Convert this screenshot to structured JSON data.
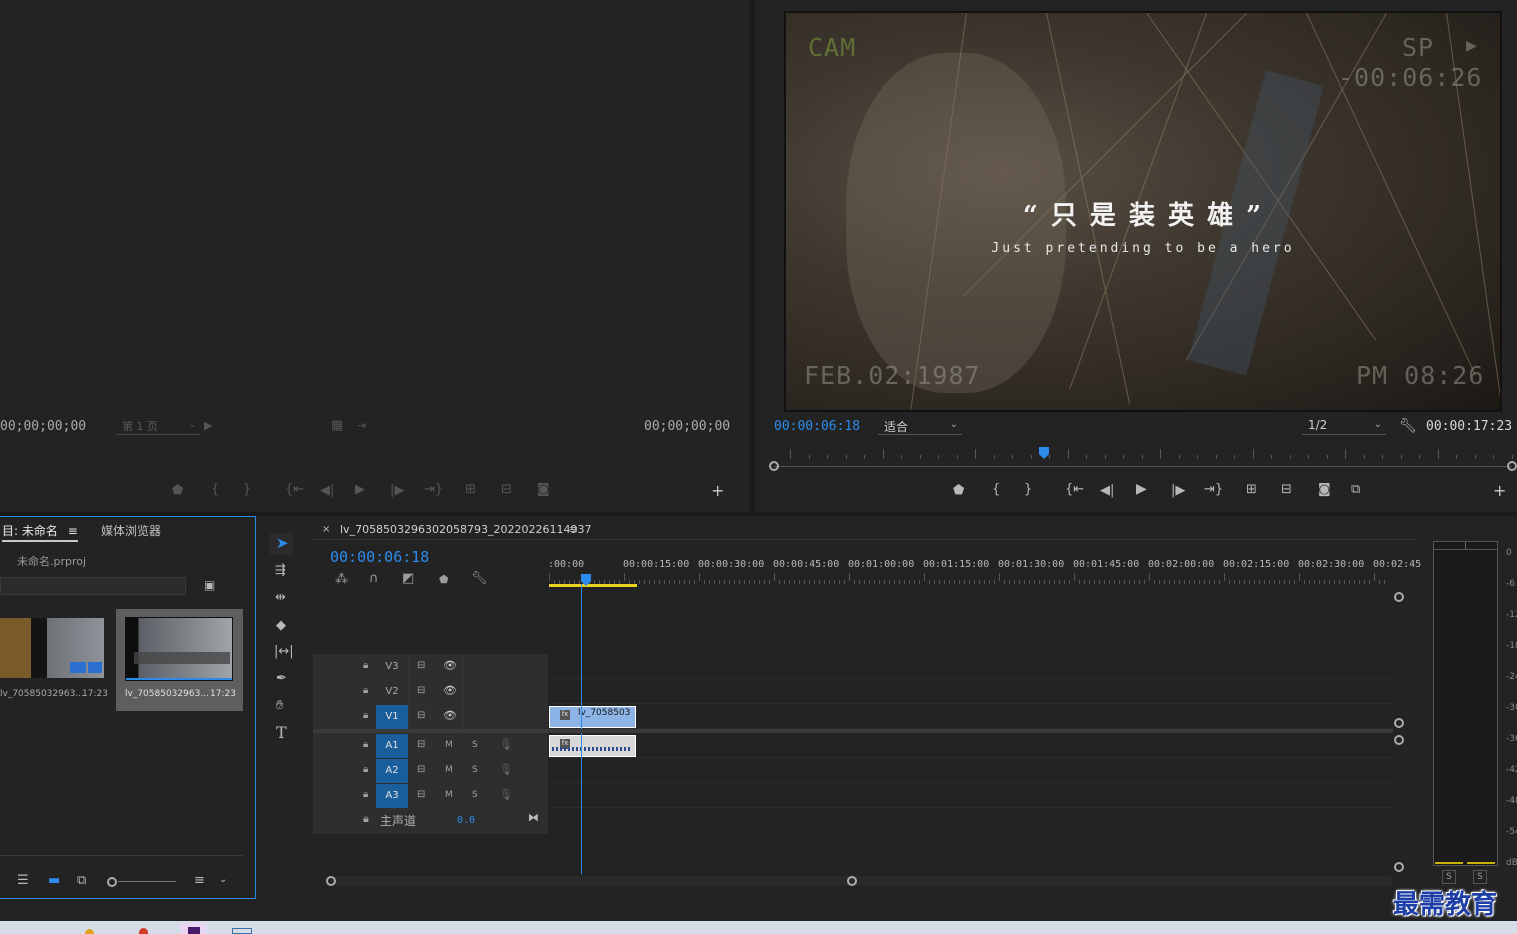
{
  "source_monitor": {
    "timecode_in": "00;00;00;00",
    "timecode_out": "00;00;00;00",
    "page_select": "第 1 页"
  },
  "program_monitor": {
    "timecode_current": "00:00:06:18",
    "fit_label": "适合",
    "resolution": "1/2",
    "timecode_duration": "00:00:17:23",
    "playhead_fraction": 0.375,
    "video": {
      "title_cn": "“ 只 是 装 英 雄 ”",
      "subtitle_en": "Just pretending to be a hero",
      "cam": "CAM",
      "sp": "SP",
      "sp_arrow": "▶",
      "counter": "-00:06:26",
      "date": "FEB.02:1987",
      "time": "PM 08:26"
    }
  },
  "project_panel": {
    "tab_project": "目: 未命名",
    "tab_media": "媒体浏览器",
    "project_file": "未命名.prproj",
    "items": [
      {
        "name": "lv_70585032963...",
        "duration": "17:23"
      },
      {
        "name": "lv_70585032963...",
        "duration": "17:23"
      }
    ]
  },
  "timeline": {
    "sequence_name": "lv_7058503296302058793_20220226114937",
    "timecode": "00:00:06:18",
    "ruler": [
      ":00:00",
      "00:00:15:00",
      "00:00:30:00",
      "00:00:45:00",
      "00:01:00:00",
      "00:01:15:00",
      "00:01:30:00",
      "00:01:45:00",
      "00:02:00:00",
      "00:02:15:00",
      "00:02:30:00",
      "00:02:45:"
    ],
    "video_tracks": [
      "V3",
      "V2",
      "V1"
    ],
    "audio_tracks": [
      "A1",
      "A2",
      "A3"
    ],
    "mute_label": "M",
    "solo_label": "S",
    "master_label": "主声道",
    "master_value": "0.0",
    "clip_label": "lv_7058503"
  },
  "meters": {
    "scale": [
      "0",
      "-6",
      "-12",
      "-18",
      "-24",
      "-30",
      "-36",
      "-42",
      "-48",
      "-54",
      "dB"
    ],
    "solo_left": "S",
    "solo_right": "S"
  },
  "watermark": "最需教育",
  "colors": {
    "accent": "#2d8ceb",
    "panel_bg": "#232323",
    "track_bg": "#2b2b2b",
    "clip_video": "#8db4e6",
    "clip_audio": "#d8d8d8",
    "work_area": "#e8d21c"
  }
}
